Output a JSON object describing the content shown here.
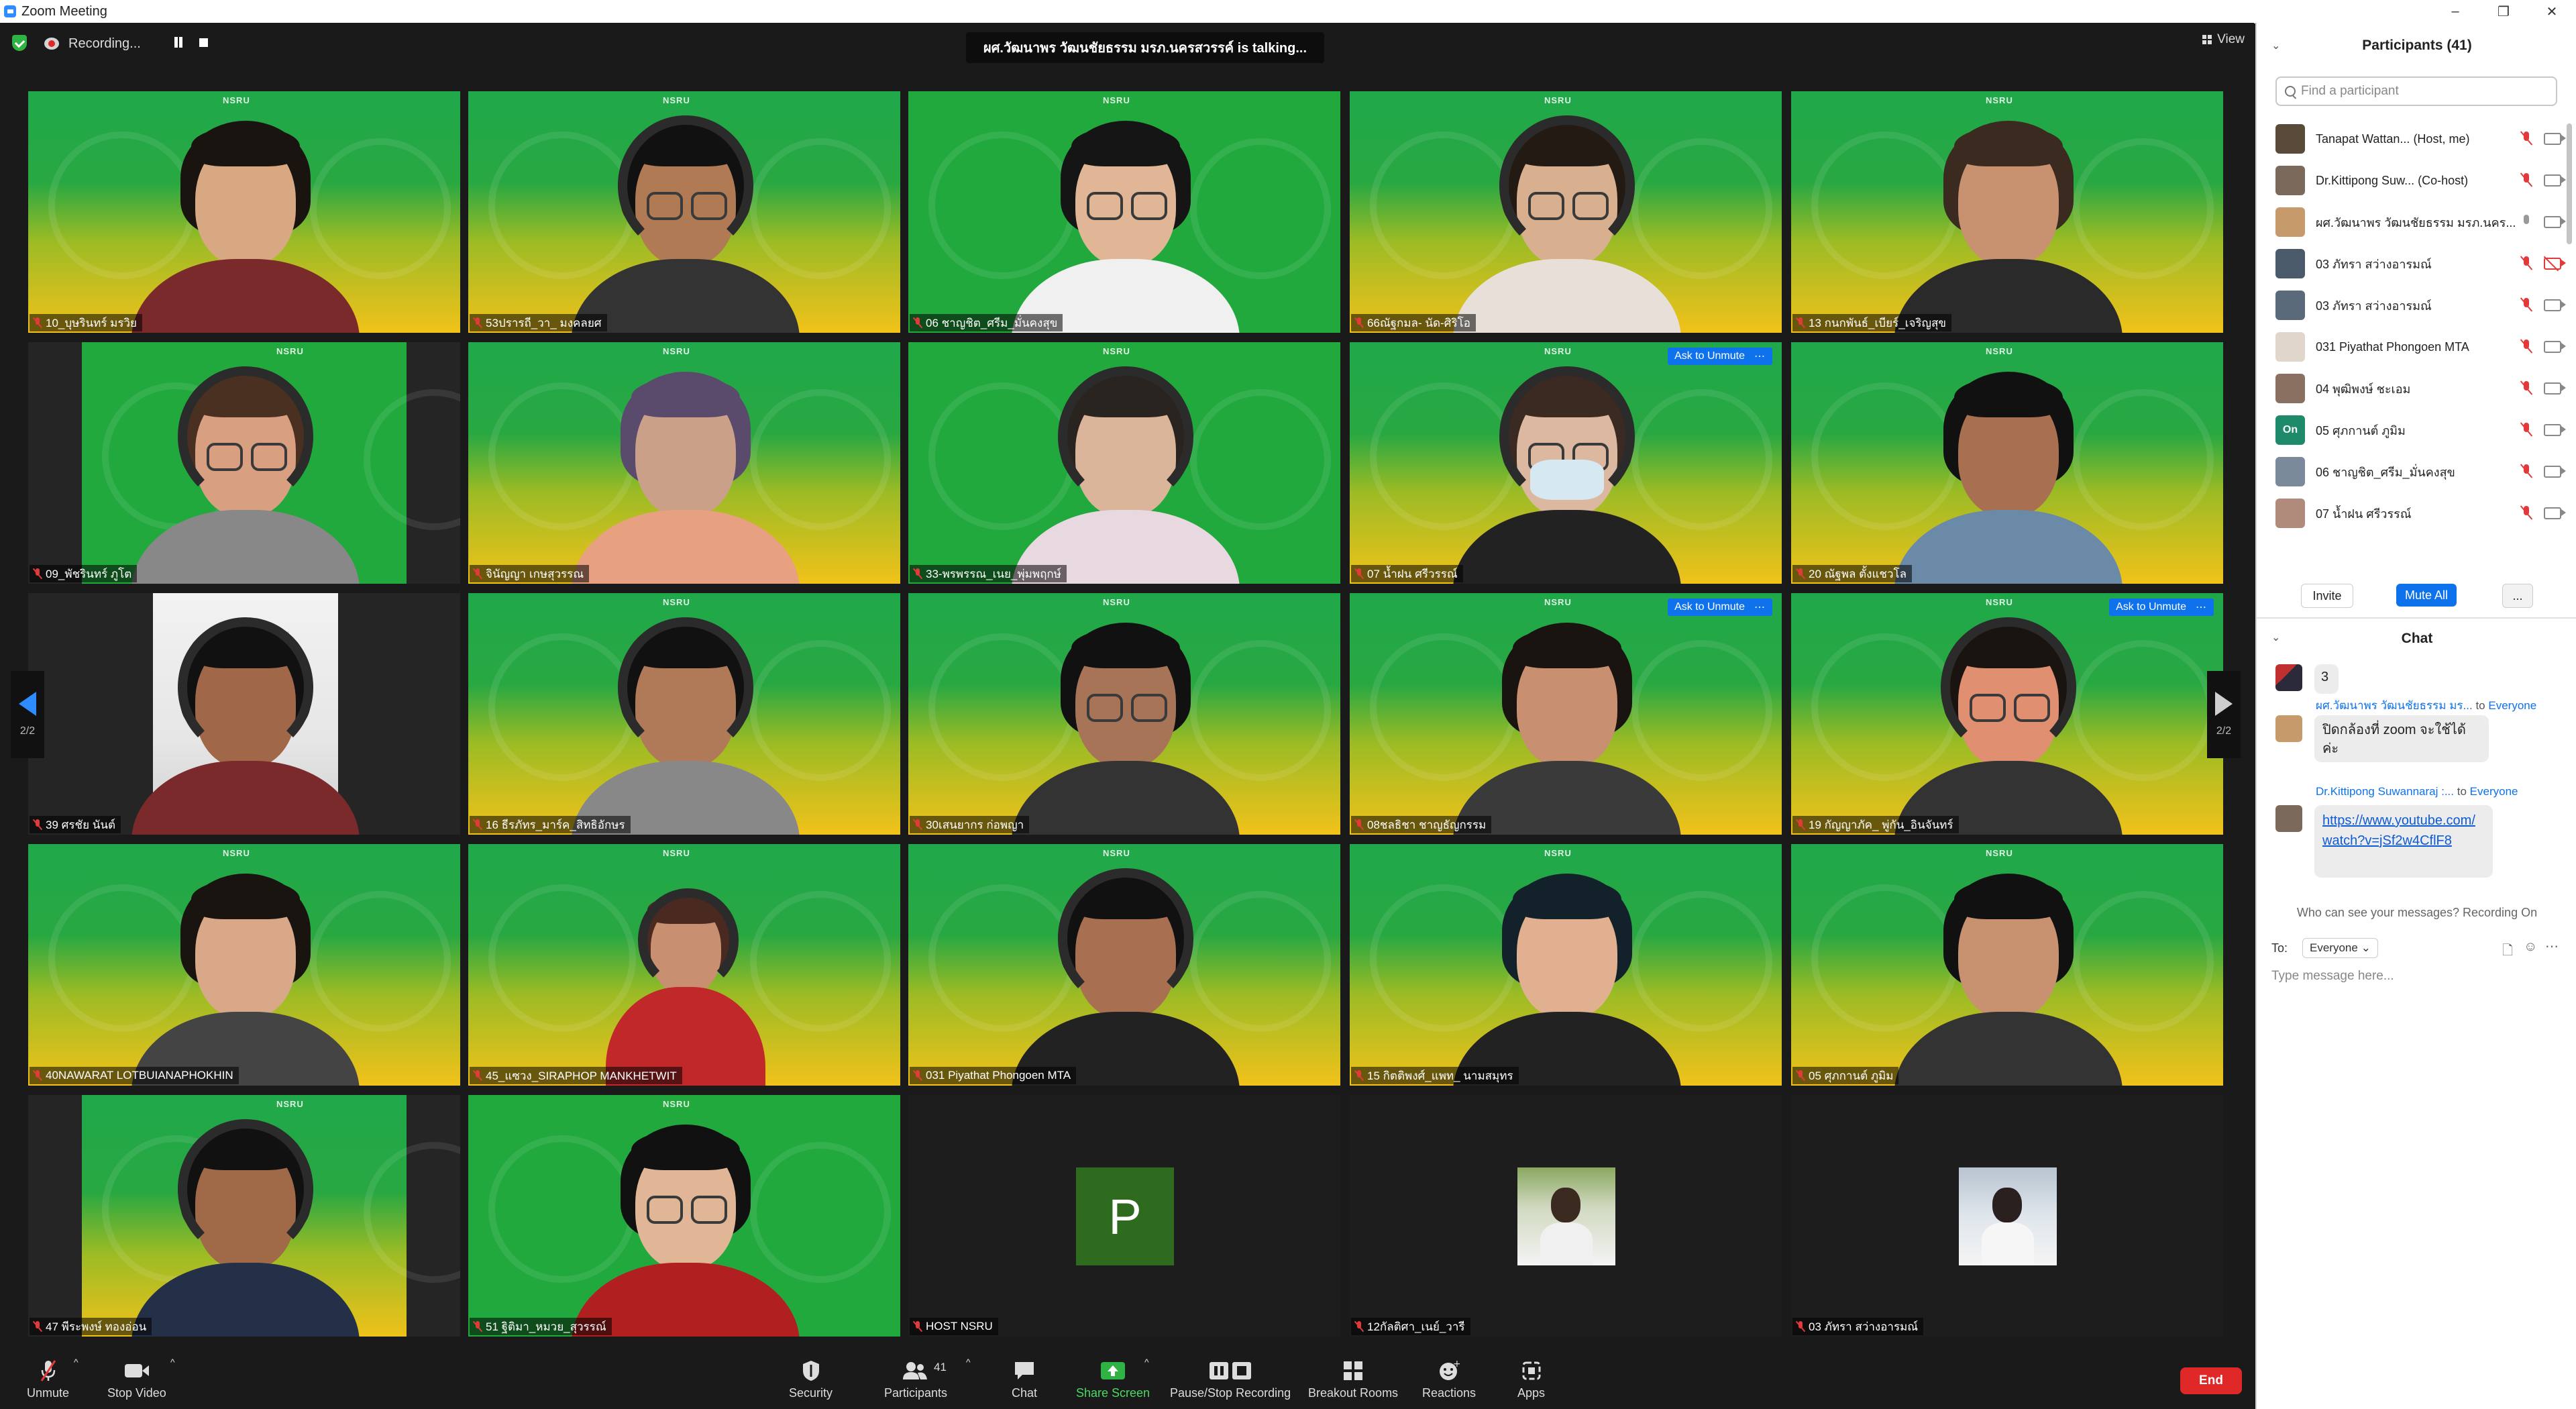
{
  "window": {
    "title": "Zoom Meeting",
    "controls": [
      "–",
      "❐",
      "✕"
    ]
  },
  "topbar": {
    "recording_label": "Recording...",
    "talking_text": "ผศ.วัฒนาพร วัฒนชัยธรรม มรภ.นครสวรรค์ is talking...",
    "view_label": "View"
  },
  "gallery": {
    "page_indicator_left": "2/2",
    "page_indicator_right": "2/2",
    "tiles": [
      {
        "name": "10_บุษรินทร์ มรวิย",
        "muted": true
      },
      {
        "name": "53ปรารถี_วา_ มงคลยศ",
        "muted": true
      },
      {
        "name": "06 ชาญชิต_ศรีม_มั่นคงสุข",
        "muted": true
      },
      {
        "name": "66ณัฐกมล- นัด-ศิริโอ",
        "muted": true
      },
      {
        "name": "13 กนกพันธ์_เบียร์_เจริญสุข",
        "muted": true
      },
      {
        "name": "09_พัชรินทร์ ภูโต",
        "muted": true
      },
      {
        "name": "จินัญญา เกษสุวรรณ",
        "muted": true
      },
      {
        "name": "33-พรพรรณ_เนย_พุ่มพฤกษ์",
        "muted": true
      },
      {
        "name": "07 น้ำฝน ศรีวรรณ์",
        "muted": true,
        "ask_unmute": "Ask to Unmute"
      },
      {
        "name": "20 ณัฐพล ตั้งแชวโล",
        "muted": true
      },
      {
        "name": "39 ศรชัย นันต์",
        "muted": true
      },
      {
        "name": "16 ธีรภัทร_มาร์ค_สิทธิอักษร",
        "muted": true
      },
      {
        "name": "30เสนยากร ก่อพญา",
        "muted": true
      },
      {
        "name": "08ชลธิชา ชาญธัญกรรม",
        "muted": true,
        "ask_unmute": "Ask to Unmute"
      },
      {
        "name": "19 กัญญาภัค_ พู่กัน_อินจันทร์",
        "muted": true,
        "ask_unmute": "Ask to Unmute"
      },
      {
        "name": "40NAWARAT LOTBUIANAPHOKHIN",
        "muted": true
      },
      {
        "name": "45_แซวง_SIRAPHOP MANKHETWIT",
        "muted": true
      },
      {
        "name": "031 Piyathat Phongoen MTA",
        "muted": true
      },
      {
        "name": "15 กิตติพงศ์_แพท_ นามสมุทร",
        "muted": true
      },
      {
        "name": "05 ศุภกานต์ ภูมิม",
        "muted": true
      },
      {
        "name": "47 พีระพงษ์ ทองอ่อน",
        "muted": true
      },
      {
        "name": "51 ฐิติมา_หมวย_สุวรรณ์",
        "muted": true
      },
      {
        "name": "HOST NSRU",
        "muted": true,
        "avatar_letter": "P"
      },
      {
        "name": "12กัลติศา_เนย์_วารี",
        "muted": true
      },
      {
        "name": "03 ภัทรา สว่างอารมณ์",
        "muted": true
      }
    ],
    "watermark": "NSRU"
  },
  "toolbar": {
    "unmute": "Unmute",
    "stop_video": "Stop Video",
    "security": "Security",
    "participants": "Participants",
    "participants_count": "41",
    "chat": "Chat",
    "share_screen": "Share Screen",
    "pause_stop_recording": "Pause/Stop Recording",
    "breakout_rooms": "Breakout Rooms",
    "reactions": "Reactions",
    "apps": "Apps",
    "end": "End"
  },
  "participants_panel": {
    "header": "Participants (41)",
    "search_placeholder": "Find a participant",
    "list": [
      {
        "name": "Tanapat Wattan...",
        "role": "(Host, me)",
        "mic": "off",
        "cam": "on",
        "av": "#5a4a3a"
      },
      {
        "name": "Dr.Kittipong Suw...",
        "role": "(Co-host)",
        "mic": "off",
        "cam": "on",
        "av": "#7b6a5c"
      },
      {
        "name": "ผศ.วัฒนาพร วัฒนชัยธรรม มรภ.นคร...",
        "role": "",
        "mic": "on",
        "cam": "on",
        "av": "#c79a6b"
      },
      {
        "name": "03 ภัทรา สว่างอารมณ์",
        "role": "",
        "mic": "off",
        "cam": "off",
        "av": "#4a5a6a"
      },
      {
        "name": "03 ภัทรา สว่างอารมณ์",
        "role": "",
        "mic": "off",
        "cam": "on",
        "av": "#5a6a7a"
      },
      {
        "name": "031 Piyathat Phongoen MTA",
        "role": "",
        "mic": "off",
        "cam": "on",
        "av": "#e0d6cc"
      },
      {
        "name": "04 พุฒิพงษ์ ชะเอม",
        "role": "",
        "mic": "off",
        "cam": "on",
        "av": "#8a7060"
      },
      {
        "name": "05 ศุภกานต์ ภูมิม",
        "role": "",
        "mic": "off",
        "cam": "on",
        "av": "#1f8a6a",
        "initials": "On"
      },
      {
        "name": "06 ชาญชิต_ศรีม_มั่นคงสุข",
        "role": "",
        "mic": "off",
        "cam": "on",
        "av": "#7a8a9a"
      },
      {
        "name": "07 น้ำฝน ศรีวรรณ์",
        "role": "",
        "mic": "off",
        "cam": "on",
        "av": "#b08a7a"
      }
    ],
    "invite": "Invite",
    "mute_all": "Mute All",
    "more": "..."
  },
  "chat_panel": {
    "header": "Chat",
    "messages": [
      {
        "sender": "",
        "to": "",
        "text": "3"
      },
      {
        "sender": "ผศ.วัฒนาพร วัฒนชัยธรรม มร...",
        "to": "Everyone",
        "text": "ปิดกล้องที่ zoom จะใช้ได้ค่ะ"
      },
      {
        "sender": "Dr.Kittipong Suwannaraj :...",
        "to": "Everyone",
        "text": "https://www.youtube.com/watch?v=jSf2w4CflF8"
      }
    ],
    "to_prefix": "to",
    "who_can_see": "Who can see your messages? Recording On",
    "to_label": "To:",
    "to_value": "Everyone",
    "input_placeholder": "Type message here..."
  }
}
